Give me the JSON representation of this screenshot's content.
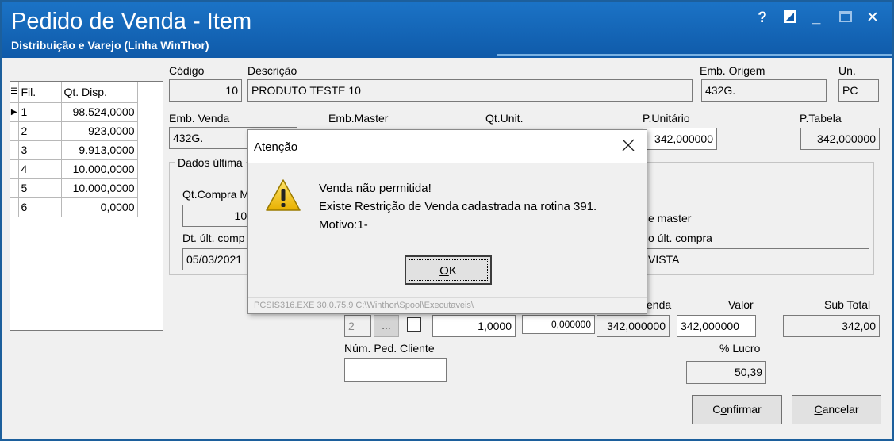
{
  "window": {
    "title": "Pedido de Venda - Item",
    "subtitle": "Distribuição e Varejo (Linha WinThor)",
    "help_label": "?",
    "minimize_label": "_",
    "close_label": "✕"
  },
  "stock_grid": {
    "col_filial": "Fil.",
    "col_qt_disp": "Qt. Disp.",
    "rows": [
      {
        "filial": "1",
        "qt": "98.524,0000",
        "selected": true
      },
      {
        "filial": "2",
        "qt": "923,0000"
      },
      {
        "filial": "3",
        "qt": "9.913,0000"
      },
      {
        "filial": "4",
        "qt": "10.000,0000"
      },
      {
        "filial": "5",
        "qt": "10.000,0000"
      },
      {
        "filial": "6",
        "qt": "0,0000"
      }
    ]
  },
  "product": {
    "codigo_label": "Código",
    "codigo": "10",
    "descricao_label": "Descrição",
    "descricao": "PRODUTO TESTE 10",
    "emb_origem_label": "Emb. Origem",
    "emb_origem": "432G.",
    "un_label": "Un.",
    "un": "PC",
    "emb_venda_label": "Emb. Venda",
    "emb_venda": "432G.",
    "emb_master_label": "Emb.Master",
    "qt_unit_label": "Qt.Unit.",
    "p_unitario_label": "P.Unitário",
    "p_unitario": "342,000000",
    "p_tabela_label": "P.Tabela",
    "p_tabela": "342,000000"
  },
  "ultimas": {
    "group_title": "Dados última",
    "qt_compra_label": "Qt.Compra M",
    "qt_compra": "10,",
    "dt_ult_label": "Dt. últ. comp",
    "dt_ult": "05/03/2021",
    "master_label": "e master",
    "ult_compra_label": "o últ. compra",
    "ult_compra": "VISTA"
  },
  "item": {
    "filial": "2",
    "ellipsis": "...",
    "quantidade": "1,0000",
    "desconto": "0,000000",
    "venda_label": "enda",
    "venda": "342,000000",
    "valor_label": "Valor",
    "valor": "342,000000",
    "subtotal_label": "Sub Total",
    "subtotal": "342,00",
    "num_ped_label": "Núm. Ped. Cliente",
    "num_ped": "",
    "lucro_label": "% Lucro",
    "lucro": "50,39"
  },
  "buttons": {
    "confirmar_mnemonic": "o",
    "confirmar_pre": "C",
    "confirmar_post": "nfirmar",
    "cancelar_pre": "",
    "cancelar_mnemonic": "C",
    "cancelar_post": "ancelar"
  },
  "dialog": {
    "title": "Atenção",
    "line1": "Venda não permitida!",
    "line2": "Existe Restrição de Venda cadastrada na rotina 391.",
    "line3": "Motivo:1-",
    "ok_mnemonic": "O",
    "ok_post": "K",
    "status": "PCSIS316.EXE 30.0.75.9 C:\\Winthor\\Spool\\Executaveis\\"
  },
  "colors": {
    "titlebar": "#1667b8",
    "warning": "#f2c200"
  }
}
